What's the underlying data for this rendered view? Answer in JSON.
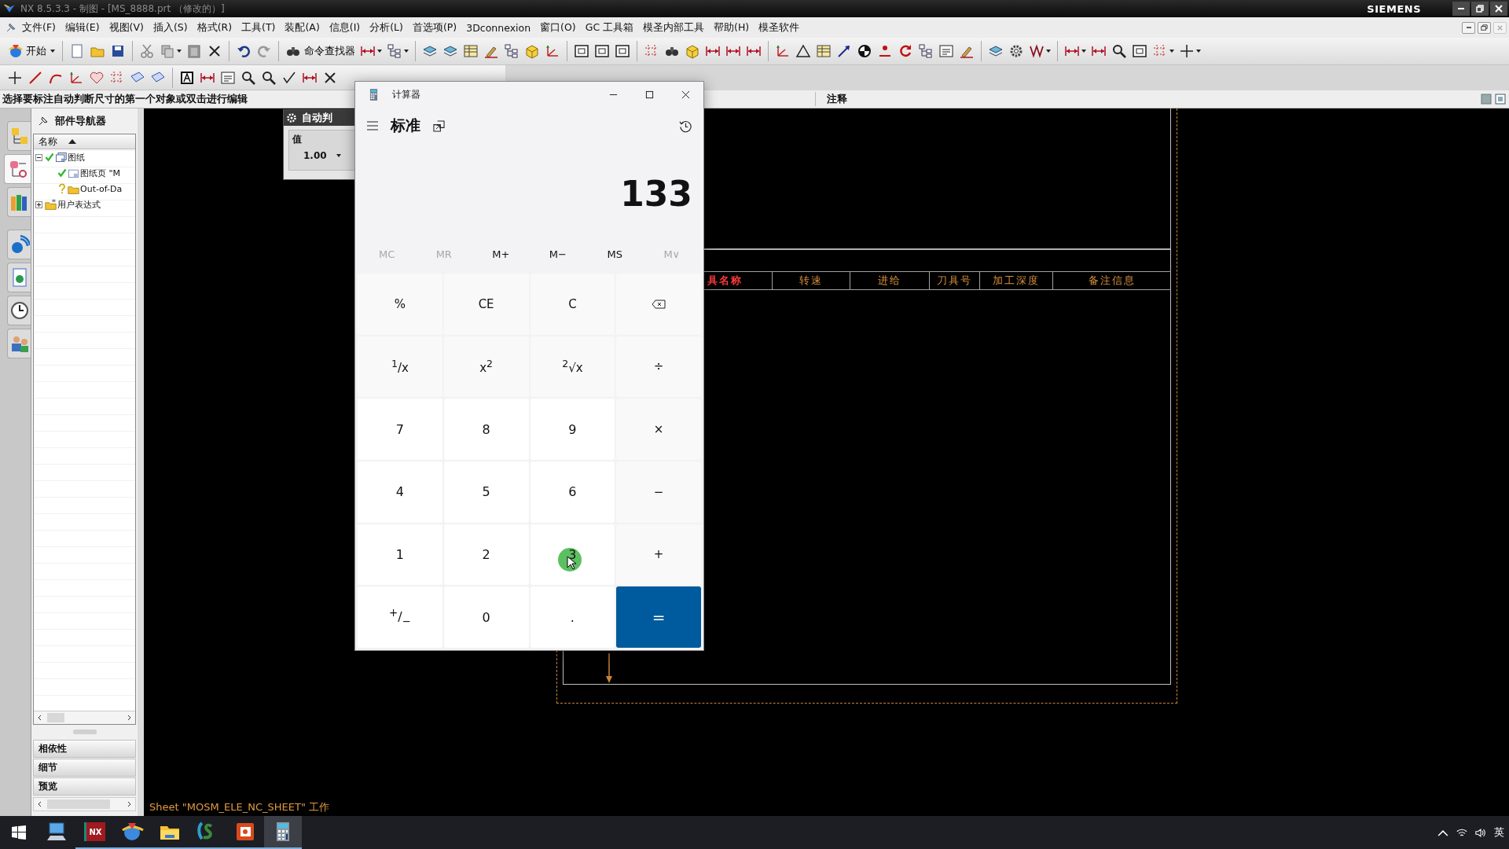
{
  "window": {
    "title": "NX 8.5.3.3 - 制图 - [MS_8888.prt （修改的）]",
    "brand": "SIEMENS"
  },
  "menu": [
    "文件(F)",
    "编辑(E)",
    "视图(V)",
    "插入(S)",
    "格式(R)",
    "工具(T)",
    "装配(A)",
    "信息(I)",
    "分析(L)",
    "首选项(P)",
    "3Dconnexion",
    "窗口(O)",
    "GC 工具箱",
    "模圣内部工具",
    "帮助(H)",
    "模圣软件"
  ],
  "toolbar": {
    "start_label": "开始",
    "command_finder_label": "命令查找器"
  },
  "prompt": {
    "text": "选择要标注自动判断尺寸的第一个对象或双击进行编辑",
    "mode": "注释"
  },
  "resource_bar": [
    {
      "selected": false
    },
    {
      "selected": true
    },
    {
      "selected": false
    },
    {
      "selected": false
    },
    {
      "selected": false
    },
    {
      "selected": false
    },
    {
      "selected": false
    }
  ],
  "navigator": {
    "title": "部件导航器",
    "column": "名称",
    "tree": [
      {
        "label": "图纸",
        "kind": "drawing",
        "checked": true,
        "unknown": false,
        "expanded": true,
        "children": [
          {
            "label": "图纸页 \"M",
            "kind": "sheet",
            "checked": true,
            "unknown": false
          },
          {
            "label": "Out-of-Da",
            "kind": "folder",
            "checked": false,
            "unknown": true
          }
        ]
      },
      {
        "label": "用户表达式",
        "kind": "expressions",
        "checked": false,
        "unknown": false,
        "expanded": false
      }
    ],
    "sections": [
      "相依性",
      "细节",
      "预览"
    ]
  },
  "dialog": {
    "title": "自动判",
    "field_label": "值",
    "value": "1.00"
  },
  "drawing": {
    "columns": [
      {
        "label": "具名称",
        "highlighted": true
      },
      {
        "label": "转速",
        "highlighted": false
      },
      {
        "label": "进给",
        "highlighted": false
      },
      {
        "label": "刀具号",
        "highlighted": false
      },
      {
        "label": "加工深度",
        "highlighted": false
      },
      {
        "label": "备注信息",
        "highlighted": false
      }
    ],
    "sheet_status": "Sheet \"MOSM_ELE_NC_SHEET\" 工作"
  },
  "calculator": {
    "title": "计算器",
    "mode": "标准",
    "display": "133",
    "memory": [
      {
        "label": "MC",
        "disabled": true
      },
      {
        "label": "MR",
        "disabled": true
      },
      {
        "label": "M+",
        "disabled": false
      },
      {
        "label": "M−",
        "disabled": false
      },
      {
        "label": "MS",
        "disabled": false
      },
      {
        "label": "M∨",
        "disabled": true
      }
    ],
    "keys": [
      {
        "label": "%",
        "kind": "op",
        "clicked": false
      },
      {
        "label": "CE",
        "kind": "op",
        "clicked": false
      },
      {
        "label": "C",
        "kind": "op",
        "clicked": false
      },
      {
        "kind": "backspace",
        "clicked": false
      },
      {
        "label": "$^{1}$/x",
        "kind": "op",
        "clicked": false
      },
      {
        "label": "x$^{2}$",
        "kind": "op",
        "clicked": false
      },
      {
        "label": "$^{2}$√x",
        "kind": "op",
        "clicked": false
      },
      {
        "label": "÷",
        "kind": "op",
        "clicked": false
      },
      {
        "label": "7",
        "kind": "digit",
        "clicked": false
      },
      {
        "label": "8",
        "kind": "digit",
        "clicked": false
      },
      {
        "label": "9",
        "kind": "digit",
        "clicked": false
      },
      {
        "label": "×",
        "kind": "op",
        "clicked": false
      },
      {
        "label": "4",
        "kind": "digit",
        "clicked": false
      },
      {
        "label": "5",
        "kind": "digit",
        "clicked": false
      },
      {
        "label": "6",
        "kind": "digit",
        "clicked": false
      },
      {
        "label": "−",
        "kind": "op",
        "clicked": false
      },
      {
        "label": "1",
        "kind": "digit",
        "clicked": false
      },
      {
        "label": "2",
        "kind": "digit",
        "clicked": false
      },
      {
        "label": "3",
        "kind": "digit",
        "clicked": true
      },
      {
        "label": "+",
        "kind": "op",
        "clicked": false
      },
      {
        "label": "$^{+}$/$_{−}$",
        "kind": "digit",
        "clicked": false
      },
      {
        "label": "0",
        "kind": "digit",
        "clicked": false
      },
      {
        "label": ".",
        "kind": "digit",
        "clicked": false
      },
      {
        "label": "=",
        "kind": "equals",
        "clicked": false
      }
    ]
  },
  "taskbar": {
    "apps": [
      {
        "kind": "computer",
        "running": false,
        "active": false
      },
      {
        "kind": "nx",
        "label": "NX",
        "running": true,
        "active": false
      },
      {
        "kind": "globe",
        "running": true,
        "active": false
      },
      {
        "kind": "folder",
        "running": true,
        "active": false
      },
      {
        "kind": "app",
        "running": true,
        "active": false
      },
      {
        "kind": "presentation",
        "running": true,
        "active": false
      },
      {
        "kind": "calculator",
        "running": true,
        "active": true
      }
    ],
    "input_indicator": "英"
  }
}
